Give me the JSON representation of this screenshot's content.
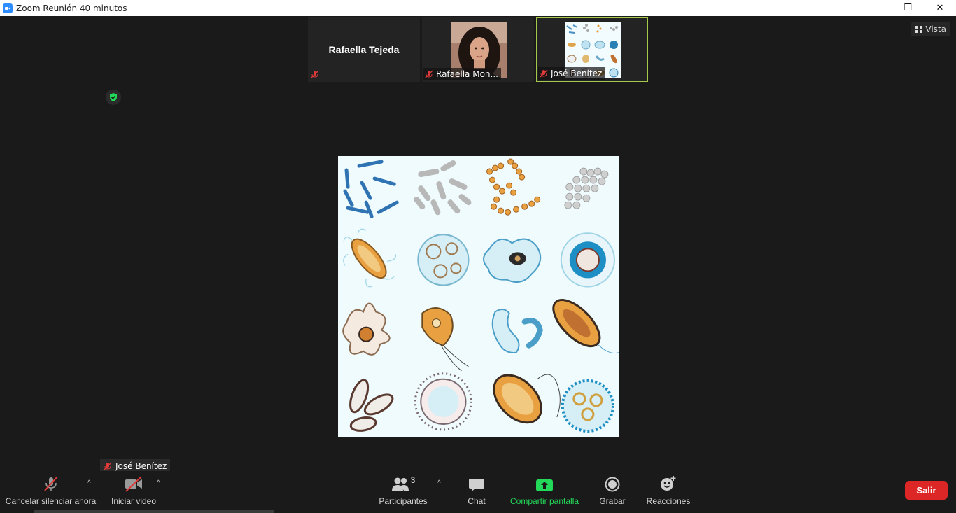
{
  "window": {
    "title": "Zoom Reunión 40 minutos",
    "minimize": "—",
    "restore": "❐",
    "close": "✕"
  },
  "participants_strip": [
    {
      "name_big": "Rafaella Tejeda",
      "label": ""
    },
    {
      "name_big": "",
      "label": "Rafaella Mon..."
    },
    {
      "name_big": "",
      "label": "José Benítez"
    }
  ],
  "view_button": {
    "label": "Vista",
    "icon": "grid-icon"
  },
  "encryption": {
    "icon": "shield-check-icon"
  },
  "self_view": {
    "label": "José Benítez"
  },
  "toolbar": {
    "mute_label": "Cancelar silenciar ahora",
    "video_label": "Iniciar video",
    "participants_label": "Participantes",
    "participants_count": "3",
    "chat_label": "Chat",
    "share_label": "Compartir pantalla",
    "record_label": "Grabar",
    "reactions_label": "Reacciones",
    "leave_label": "Salir",
    "caret": "^"
  },
  "colors": {
    "accent_share": "#23d959",
    "leave": "#dd2727",
    "active_border": "#a5c94a",
    "muted_red": "#e03a3a"
  }
}
